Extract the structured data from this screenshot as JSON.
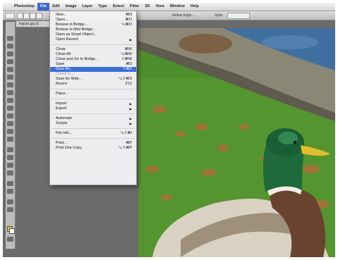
{
  "menubar": {
    "apple_icon": "apple-icon",
    "items": [
      "Photoshop",
      "File",
      "Edit",
      "Image",
      "Layer",
      "Type",
      "Select",
      "Filter",
      "3D",
      "View",
      "Window",
      "Help"
    ],
    "active": "File"
  },
  "options_bar": {
    "labels": [
      "Refine Edge...",
      "Style:"
    ]
  },
  "document_tab": {
    "label": "Teglo01.jpg @"
  },
  "file_menu": {
    "items": [
      {
        "label": "New...",
        "shortcut": "⌘N"
      },
      {
        "label": "Open...",
        "shortcut": "⌘O"
      },
      {
        "label": "Browse in Bridge...",
        "shortcut": "⌥⌘O"
      },
      {
        "label": "Browse in Mini Bridge...",
        "shortcut": ""
      },
      {
        "label": "Open as Smart Object...",
        "shortcut": ""
      },
      {
        "label": "Open Recent",
        "submenu": true
      },
      {
        "label": "Close",
        "shortcut": "⌘W"
      },
      {
        "label": "Close All",
        "shortcut": "⌥⌘W"
      },
      {
        "label": "Close and Go to Bridge...",
        "shortcut": "⇧⌘W"
      },
      {
        "label": "Save",
        "shortcut": "⌘S"
      },
      {
        "label": "Save As...",
        "shortcut": "⇧⌘S",
        "highlighted": true
      },
      {
        "label": "Check In...",
        "disabled": true
      },
      {
        "label": "Save for Web...",
        "shortcut": "⌥⇧⌘S"
      },
      {
        "label": "Revert",
        "shortcut": "F12"
      },
      {
        "label": "Place..."
      },
      {
        "label": "Import",
        "submenu": true
      },
      {
        "label": "Export",
        "submenu": true
      },
      {
        "label": "Automate",
        "submenu": true
      },
      {
        "label": "Scripts",
        "submenu": true
      },
      {
        "label": "File Info...",
        "shortcut": "⌥⇧⌘I"
      },
      {
        "label": "Print...",
        "shortcut": "⌘P"
      },
      {
        "label": "Print One Copy",
        "shortcut": "⌥⇧⌘P"
      }
    ]
  },
  "colors": {
    "menu_highlight": "#3a6fd8",
    "foreground_swatch": "#e6c020",
    "background_swatch": "#ffffff"
  }
}
